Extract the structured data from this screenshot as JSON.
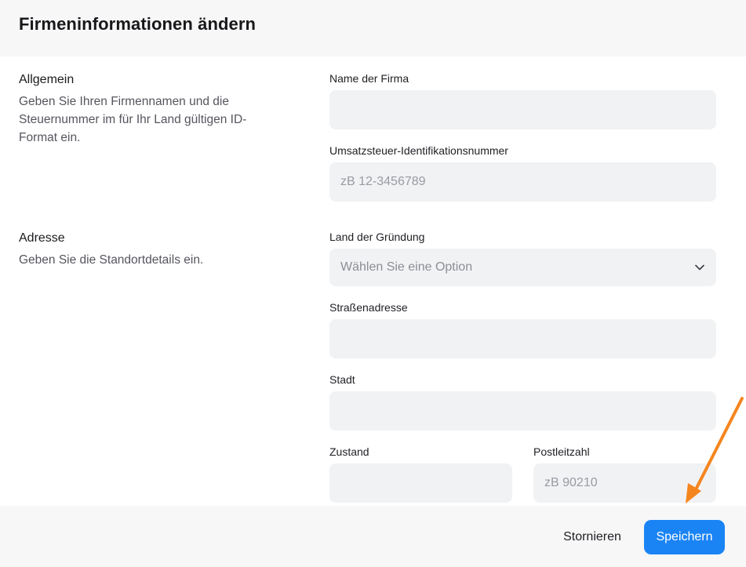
{
  "dialog": {
    "title": "Firmeninformationen ändern"
  },
  "sections": {
    "general": {
      "title": "Allgemein",
      "description": "Geben Sie Ihren Firmennamen und die Steuernummer im für Ihr Land gültigen ID-Format ein."
    },
    "address": {
      "title": "Adresse",
      "description": "Geben Sie die Standortdetails ein."
    }
  },
  "fields": {
    "company_name": {
      "label": "Name der Firma",
      "value": "",
      "placeholder": ""
    },
    "vat_id": {
      "label": "Umsatzsteuer-Identifikationsnummer",
      "value": "",
      "placeholder": "zB 12-3456789"
    },
    "country": {
      "label": "Land der Gründung",
      "selected": "Wählen Sie eine Option"
    },
    "street": {
      "label": "Straßenadresse",
      "value": "",
      "placeholder": ""
    },
    "city": {
      "label": "Stadt",
      "value": "",
      "placeholder": ""
    },
    "state": {
      "label": "Zustand",
      "value": "",
      "placeholder": ""
    },
    "zip": {
      "label": "Postleitzahl",
      "value": "",
      "placeholder": "zB 90210"
    }
  },
  "footer": {
    "cancel_label": "Stornieren",
    "save_label": "Speichern"
  },
  "colors": {
    "accent": "#1b84f5",
    "annotation_arrow": "#f5861f"
  }
}
